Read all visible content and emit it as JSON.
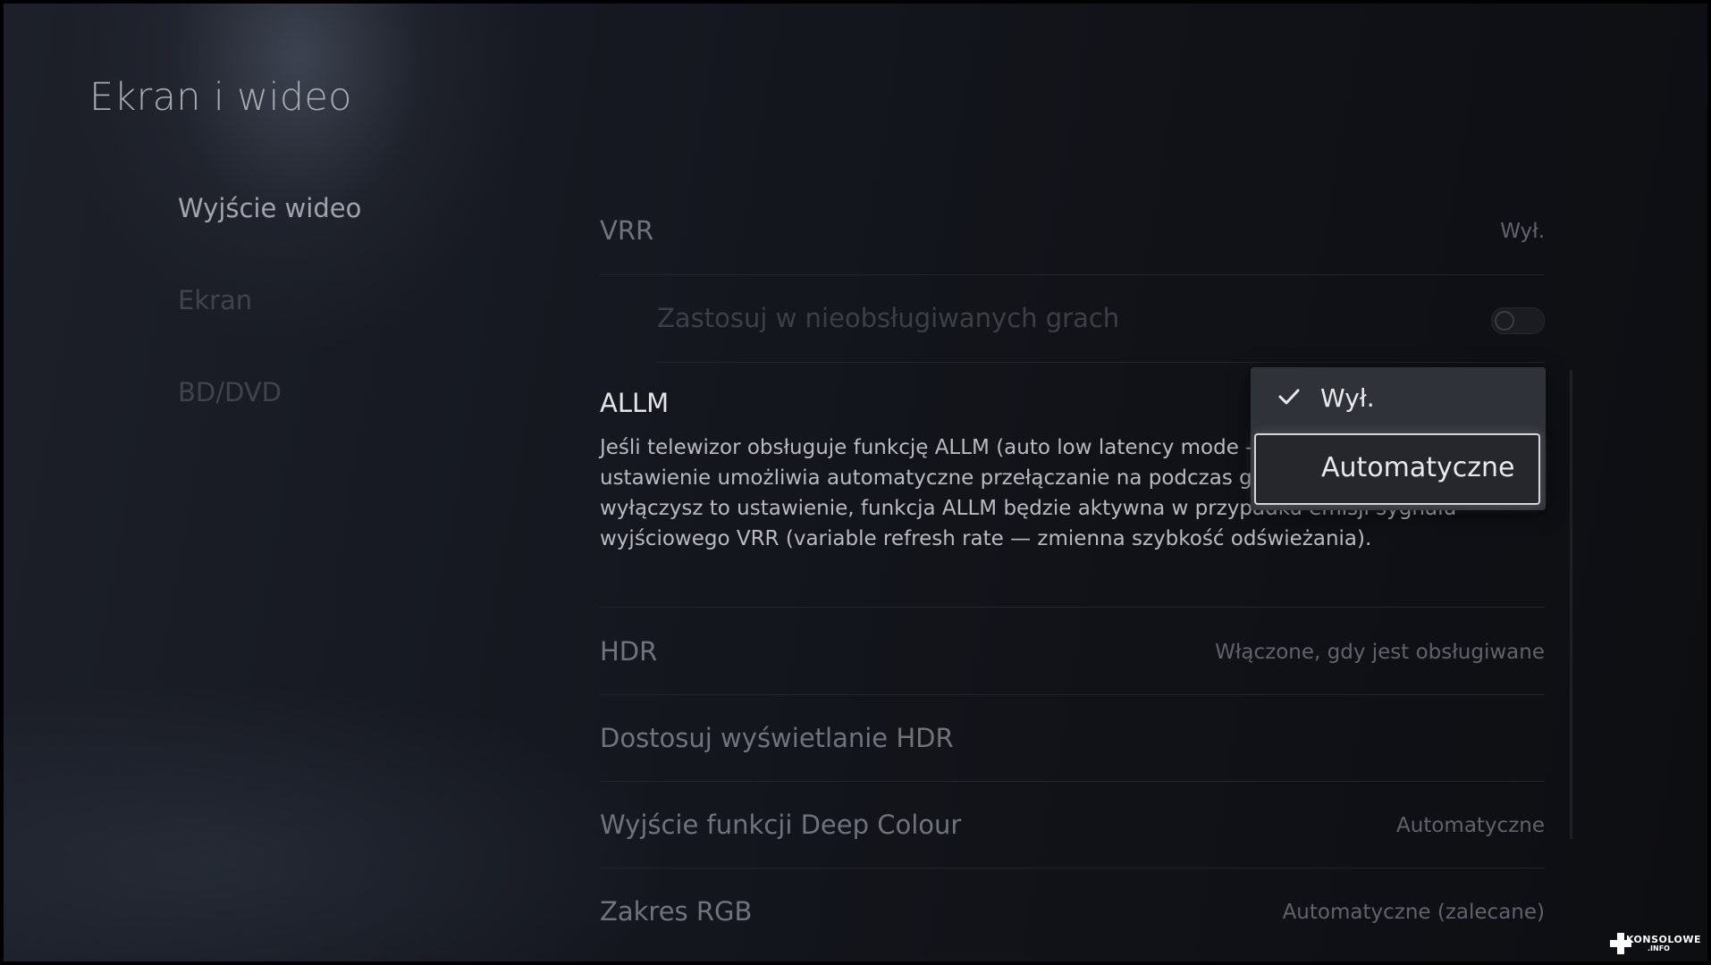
{
  "page": {
    "title": "Ekran i wideo"
  },
  "nav": {
    "items": [
      "Wyjście wideo",
      "Ekran",
      "BD/DVD"
    ]
  },
  "settings": {
    "vrr": {
      "label": "VRR",
      "value": "Wył."
    },
    "unsupported_games": {
      "label": "Zastosuj w nieobsługiwanych grach",
      "toggle_on": false
    },
    "allm": {
      "label": "ALLM",
      "description": "Jeśli telewizor obsługuje funkcję ALLM (auto low latency mode — tryb opóźnienia), to ustawienie umożliwia automatyczne przełączanie na podczas grania w gry. Nawet jeśli wyłączysz to ustawienie, funkcja ALLM będzie aktywna w przypadku emisji sygnału wyjściowego VRR (variable refresh rate — zmienna szybkość odświeżania)."
    },
    "hdr": {
      "label": "HDR",
      "value": "Włączone, gdy jest obsługiwane"
    },
    "hdr_adjust": {
      "label": "Dostosuj wyświetlanie HDR"
    },
    "deep_colour": {
      "label": "Wyjście funkcji Deep Colour",
      "value": "Automatyczne"
    },
    "rgb_range": {
      "label": "Zakres RGB",
      "value": "Automatyczne (zalecane)"
    }
  },
  "dropdown": {
    "options": [
      {
        "label": "Wył.",
        "selected": true,
        "focused": false
      },
      {
        "label": "Automatyczne",
        "selected": false,
        "focused": true
      }
    ]
  },
  "watermark": {
    "brand": "KONSOLOWE",
    "domain": ".INFO"
  }
}
